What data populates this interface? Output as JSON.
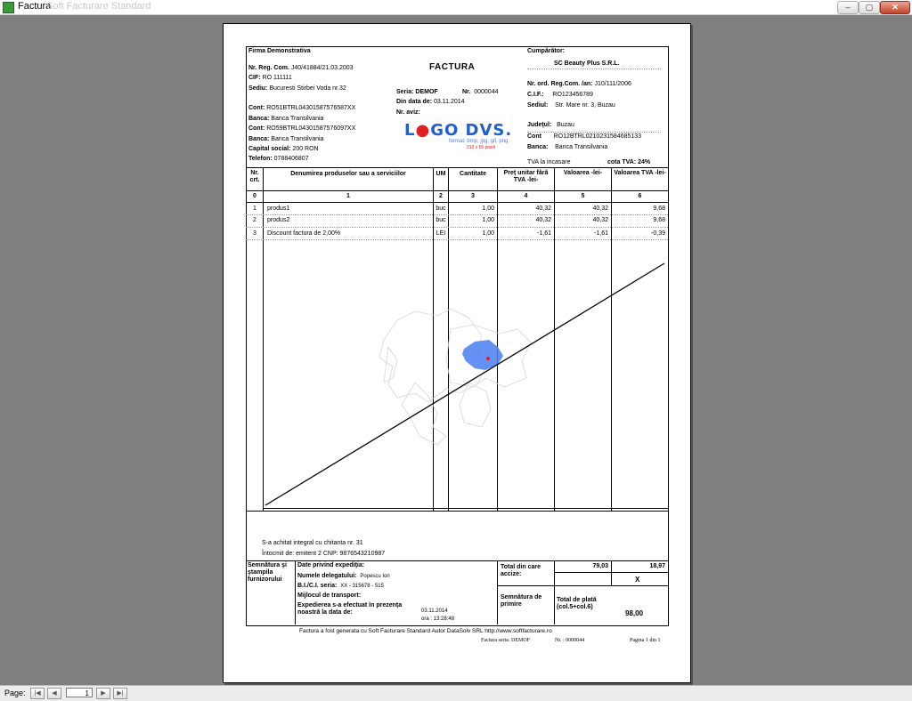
{
  "window": {
    "title": "Factura",
    "subtitle": "Soft Facturare Standard",
    "buttons": {
      "minimize": "–",
      "maximize": "▢",
      "close": "✕"
    }
  },
  "seller": {
    "name": "Firma Demonstrativa",
    "reg_label": "Nr. Reg. Com.",
    "reg_value": "J40/41884/21.03.2003",
    "cif_label": "CIF:",
    "cif_value": "RO 111111",
    "sediu_label": "Sediu:",
    "sediu_value": "Bucuresti Stirbei Voda nr.32",
    "cont1_label": "Cont:",
    "cont1_value": "RO51BTRL04301587576587XX",
    "banca1_label": "Banca:",
    "banca1_value": "Banca Transilvania",
    "cont2_label": "Cont:",
    "cont2_value": "RO59BTRL04301587576097XX",
    "banca2_label": "Banca:",
    "banca2_value": "Banca Transilvania",
    "capital_label": "Capital social:",
    "capital_value": "200 RON",
    "tel_label": "Telefon:",
    "tel_value": "0788406807"
  },
  "document": {
    "title": "FACTURA",
    "seria_label": "Seria: DEMOF",
    "nr_label": "Nr.",
    "nr_value": "0000044",
    "date_label": "Din data de:",
    "date_value": "03.11.2014",
    "aviz_label": "Nr. aviz:",
    "logo_text_1": "L",
    "logo_text_2": "GO DVS.",
    "logo_format": "format: bmp, jpg, gif, png",
    "logo_size": "210 x 55 pixeli"
  },
  "buyer": {
    "label": "Cumpărător:",
    "name": "SC Beauty Plus S.R.L.",
    "reg_label": "Nr. ord. Reg.Com. /an:",
    "reg_value": "J10/111/2006",
    "cif_label": "C.I.F.:",
    "cif_value": "RO123456789",
    "sediu_label": "Sediul:",
    "sediu_value": "Str. Mare nr. 3, Buzau",
    "judet_label": "Judeţul:",
    "judet_value": "Buzau",
    "cont_label": "Cont",
    "cont_value": "RO12BTRL0210231584685133",
    "banca_label": "Banca:",
    "banca_value": "Banca Transilvania",
    "tva_note": "TVA la incasare",
    "cota_label": "cota TVA: 24%"
  },
  "table": {
    "headers": [
      "Nr. crt.",
      "Denumirea produselor sau a serviciilor",
      "UM",
      "Cantitate",
      "Preţ unitar fără TVA -lei-",
      "Valoarea -lei-",
      "Valoarea TVA -lei-"
    ],
    "index_row": [
      "0",
      "1",
      "2",
      "3",
      "4",
      "5",
      "6"
    ],
    "rows": [
      [
        "1",
        "produs1",
        "buc",
        "1,00",
        "40,32",
        "40,32",
        "9,68"
      ],
      [
        "2",
        "produs2",
        "buc",
        "1,00",
        "40,32",
        "40,32",
        "9,68"
      ],
      [
        "3",
        "Discount factura de 2,00%",
        "LEI",
        "1,00",
        "-1,61",
        "-1,61",
        "-0,39"
      ]
    ]
  },
  "notes": {
    "line1": "S-a achitat integral cu chitanta nr. 31",
    "line2": "Întocmit de: emitent 2  CNP: 9876543210987"
  },
  "footer": {
    "sign_label": "Semnătura şi ştampila furnizorului",
    "exp_title": "Date privind expediţia:",
    "delegat_label": "Numele delegatului:",
    "delegat_value": "Popescu Ion",
    "bi_label": "B.I./C.I. seria:",
    "bi_value": "XX - 315678 - 515",
    "transport_label": "Mijlocul de transport:",
    "exp_label": "Expedierea s-a efectuat în prezenţa noastră la data de:",
    "exp_date": "03.11.2014",
    "exp_time": "ora : 13:28:48",
    "total_label": "Total din care accize:",
    "total_val": "79,03",
    "total_tva": "18,97",
    "accize_mark": "X",
    "primire_label": "Semnătura de primire",
    "plata_label": "Total de plată (col.5+col.6)",
    "plata_value": "98,00",
    "generated": "Factura a fost generata cu Soft Facturare Standard Autor DataSolv SRL http://www.softfacturare.ro",
    "seria_bottom": "Factura seria:  DEMOF",
    "nr_bottom": "Nr. :  0000044",
    "pagina": "Pagina 1 din 1"
  },
  "statusbar": {
    "page_label": "Page:",
    "page_value": "1",
    "nav_first": "|◀",
    "nav_prev": "◀",
    "nav_next": "▶",
    "nav_last": "▶|"
  },
  "colors": {
    "logo_blue": "#1f5fd0",
    "logo_red": "#e02020",
    "map_fill": "#4a7ef0"
  }
}
